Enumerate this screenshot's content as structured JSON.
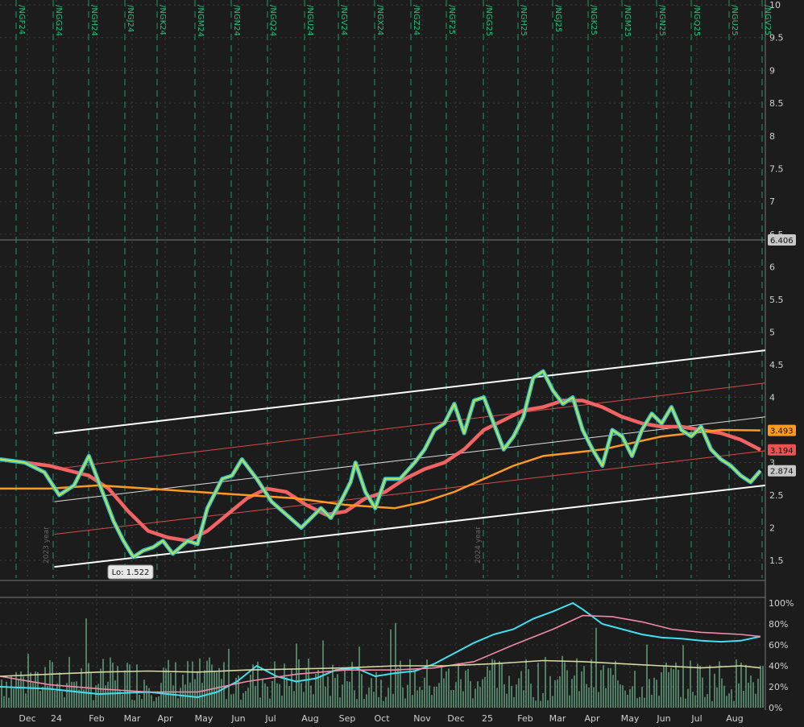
{
  "chart_data": [
    {
      "type": "candlestick",
      "panel": "price",
      "style": {
        "background": "#1c1c1c",
        "grid": "dashed",
        "grid_color": "#3c3c3c",
        "contract_line_color": "#1c9c64"
      },
      "x_labels": [
        "Dec",
        "24",
        "Feb",
        "Mar",
        "Apr",
        "May",
        "Jun",
        "Jul",
        "Aug",
        "Sep",
        "Oct",
        "Nov",
        "Dec",
        "25",
        "Feb",
        "Mar",
        "Apr",
        "May",
        "Jun",
        "Jul",
        "Aug"
      ],
      "contract_labels": [
        "/NGF24",
        "/NGG24",
        "/NGH24",
        "/NGJ24",
        "/NGK24",
        "/NGM24",
        "/NGN24",
        "/NGQ24",
        "/NGU24",
        "/NGV24",
        "/NGX24",
        "/NGZ24",
        "/NGF25",
        "/NGG25",
        "/NGH25",
        "/NGJ25",
        "/NGK25",
        "/NGM25",
        "/NGN25",
        "/NGQ25",
        "/NGU25",
        "/NGV25"
      ],
      "year_labels": [
        "2023 year",
        "2024 year"
      ],
      "y_ticks_upper": [
        "10",
        "9.5",
        "9",
        "8.5",
        "8",
        "7.5",
        "7",
        "6.5"
      ],
      "y_ticks_lower": [
        "6",
        "5.5",
        "5",
        "4.5",
        "4",
        "3.5",
        "3",
        "2.5",
        "2",
        "1.5"
      ],
      "y_break_label": "6.406",
      "ylim": [
        1.3,
        10
      ],
      "price_points": [
        [
          0,
          3.05
        ],
        [
          5,
          3.0
        ],
        [
          9,
          2.85
        ],
        [
          12,
          2.5
        ],
        [
          15,
          2.65
        ],
        [
          18,
          3.1
        ],
        [
          21,
          2.5
        ],
        [
          23,
          2.1
        ],
        [
          25,
          1.8
        ],
        [
          27,
          1.55
        ],
        [
          29,
          1.65
        ],
        [
          31,
          1.7
        ],
        [
          33,
          1.8
        ],
        [
          35,
          1.6
        ],
        [
          38,
          1.8
        ],
        [
          40,
          1.75
        ],
        [
          42,
          2.3
        ],
        [
          45,
          2.75
        ],
        [
          47,
          2.8
        ],
        [
          49,
          3.05
        ],
        [
          52,
          2.75
        ],
        [
          55,
          2.4
        ],
        [
          58,
          2.2
        ],
        [
          61,
          2.0
        ],
        [
          63,
          2.15
        ],
        [
          65,
          2.3
        ],
        [
          67,
          2.15
        ],
        [
          69,
          2.4
        ],
        [
          71,
          2.7
        ],
        [
          72,
          3.0
        ],
        [
          74,
          2.55
        ],
        [
          76,
          2.3
        ],
        [
          78,
          2.75
        ],
        [
          81,
          2.75
        ],
        [
          84,
          3.0
        ],
        [
          86,
          3.2
        ],
        [
          88,
          3.5
        ],
        [
          90,
          3.6
        ],
        [
          92,
          3.9
        ],
        [
          94,
          3.45
        ],
        [
          96,
          3.95
        ],
        [
          98,
          4.0
        ],
        [
          100,
          3.6
        ],
        [
          102,
          3.2
        ],
        [
          104,
          3.4
        ],
        [
          106,
          3.7
        ],
        [
          108,
          4.3
        ],
        [
          110,
          4.4
        ],
        [
          112,
          4.1
        ],
        [
          114,
          3.9
        ],
        [
          116,
          4.0
        ],
        [
          118,
          3.5
        ],
        [
          120,
          3.2
        ],
        [
          122,
          2.95
        ],
        [
          124,
          3.5
        ],
        [
          126,
          3.4
        ],
        [
          128,
          3.1
        ],
        [
          130,
          3.5
        ],
        [
          132,
          3.75
        ],
        [
          134,
          3.6
        ],
        [
          136,
          3.85
        ],
        [
          138,
          3.5
        ],
        [
          140,
          3.4
        ],
        [
          142,
          3.55
        ],
        [
          144,
          3.2
        ],
        [
          146,
          3.05
        ],
        [
          148,
          2.95
        ],
        [
          150,
          2.8
        ],
        [
          152,
          2.7
        ],
        [
          154,
          2.874
        ]
      ],
      "series": [
        {
          "name": "",
          "color": "#f26464",
          "values": [
            [
              0,
              3.05
            ],
            [
              10,
              2.95
            ],
            [
              18,
              2.8
            ],
            [
              22,
              2.6
            ],
            [
              26,
              2.25
            ],
            [
              30,
              1.95
            ],
            [
              34,
              1.85
            ],
            [
              38,
              1.8
            ],
            [
              42,
              1.95
            ],
            [
              46,
              2.2
            ],
            [
              50,
              2.45
            ],
            [
              54,
              2.6
            ],
            [
              58,
              2.55
            ],
            [
              62,
              2.35
            ],
            [
              66,
              2.2
            ],
            [
              70,
              2.25
            ],
            [
              74,
              2.45
            ],
            [
              78,
              2.55
            ],
            [
              82,
              2.75
            ],
            [
              86,
              2.9
            ],
            [
              90,
              3.0
            ],
            [
              94,
              3.2
            ],
            [
              98,
              3.5
            ],
            [
              102,
              3.65
            ],
            [
              106,
              3.8
            ],
            [
              110,
              3.85
            ],
            [
              114,
              3.95
            ],
            [
              118,
              3.95
            ],
            [
              122,
              3.85
            ],
            [
              126,
              3.7
            ],
            [
              130,
              3.6
            ],
            [
              134,
              3.55
            ],
            [
              138,
              3.55
            ],
            [
              142,
              3.5
            ],
            [
              146,
              3.45
            ],
            [
              150,
              3.35
            ],
            [
              154,
              3.194
            ]
          ]
        },
        {
          "name": "",
          "color": "#ff9a1e",
          "values": [
            [
              0,
              2.6
            ],
            [
              10,
              2.6
            ],
            [
              20,
              2.65
            ],
            [
              30,
              2.6
            ],
            [
              40,
              2.55
            ],
            [
              50,
              2.5
            ],
            [
              60,
              2.45
            ],
            [
              70,
              2.35
            ],
            [
              80,
              2.3
            ],
            [
              86,
              2.4
            ],
            [
              92,
              2.55
            ],
            [
              98,
              2.75
            ],
            [
              104,
              2.95
            ],
            [
              110,
              3.1
            ],
            [
              116,
              3.15
            ],
            [
              122,
              3.2
            ],
            [
              128,
              3.3
            ],
            [
              134,
              3.4
            ],
            [
              140,
              3.45
            ],
            [
              146,
              3.5
            ],
            [
              154,
              3.493
            ]
          ]
        }
      ],
      "channel": {
        "color": "#ffffff",
        "upper": [
          [
            11,
            3.45
          ],
          [
            155,
            4.72
          ]
        ],
        "middle": [
          [
            11,
            2.4
          ],
          [
            155,
            3.7
          ]
        ],
        "lower": [
          [
            11,
            1.4
          ],
          [
            155,
            2.65
          ]
        ],
        "inner_upper": [
          [
            11,
            2.9
          ],
          [
            155,
            4.22
          ]
        ],
        "inner_lower": [
          [
            11,
            1.9
          ],
          [
            155,
            3.18
          ]
        ]
      },
      "price_labels": [
        {
          "text": "6.406",
          "color": "#c8c8c8",
          "y": 6.406
        },
        {
          "text": "3.493",
          "color": "#ff9a1e",
          "y": 3.493
        },
        {
          "text": "3.194",
          "color": "#f05050",
          "y": 3.194
        },
        {
          "text": "2.874",
          "color": "#c8c8c8",
          "y": 2.874
        }
      ],
      "low_marker": {
        "text": "Lo: 1.522",
        "value": 1.522
      }
    },
    {
      "type": "bar",
      "panel": "volume",
      "y_ticks": [
        "100%",
        "80%",
        "60%",
        "40%",
        "20%",
        "0%"
      ],
      "ylim": [
        0,
        100
      ],
      "bar_color": "#7fd6a8",
      "series": [
        {
          "name": "",
          "color": "#3fe0f0",
          "values": [
            [
              0,
              20
            ],
            [
              10,
              18
            ],
            [
              20,
              13
            ],
            [
              30,
              15
            ],
            [
              40,
              10
            ],
            [
              44,
              15
            ],
            [
              48,
              25
            ],
            [
              52,
              40
            ],
            [
              56,
              30
            ],
            [
              60,
              25
            ],
            [
              64,
              28
            ],
            [
              68,
              36
            ],
            [
              72,
              38
            ],
            [
              76,
              30
            ],
            [
              80,
              33
            ],
            [
              84,
              35
            ],
            [
              88,
              42
            ],
            [
              92,
              52
            ],
            [
              96,
              62
            ],
            [
              100,
              70
            ],
            [
              104,
              75
            ],
            [
              108,
              85
            ],
            [
              112,
              92
            ],
            [
              116,
              100
            ],
            [
              118,
              94
            ],
            [
              122,
              80
            ],
            [
              126,
              75
            ],
            [
              130,
              70
            ],
            [
              134,
              67
            ],
            [
              138,
              66
            ],
            [
              142,
              64
            ],
            [
              146,
              63
            ],
            [
              150,
              64
            ],
            [
              154,
              68
            ]
          ]
        },
        {
          "name": "",
          "color": "#f28aa8",
          "values": [
            [
              0,
              30
            ],
            [
              10,
              22
            ],
            [
              20,
              18
            ],
            [
              30,
              15
            ],
            [
              40,
              15
            ],
            [
              50,
              25
            ],
            [
              60,
              32
            ],
            [
              70,
              36
            ],
            [
              80,
              36
            ],
            [
              88,
              38
            ],
            [
              96,
              44
            ],
            [
              104,
              60
            ],
            [
              112,
              75
            ],
            [
              118,
              88
            ],
            [
              124,
              87
            ],
            [
              130,
              82
            ],
            [
              136,
              75
            ],
            [
              142,
              72
            ],
            [
              150,
              70
            ],
            [
              154,
              68
            ]
          ]
        },
        {
          "name": "",
          "color": "#d8d8a0",
          "values": [
            [
              0,
              30
            ],
            [
              10,
              32
            ],
            [
              20,
              34
            ],
            [
              30,
              35
            ],
            [
              40,
              34
            ],
            [
              50,
              36
            ],
            [
              60,
              37
            ],
            [
              70,
              38
            ],
            [
              80,
              40
            ],
            [
              90,
              40
            ],
            [
              100,
              42
            ],
            [
              110,
              45
            ],
            [
              118,
              44
            ],
            [
              126,
              42
            ],
            [
              134,
              40
            ],
            [
              142,
              38
            ],
            [
              150,
              40
            ],
            [
              154,
              38
            ]
          ]
        }
      ]
    }
  ]
}
